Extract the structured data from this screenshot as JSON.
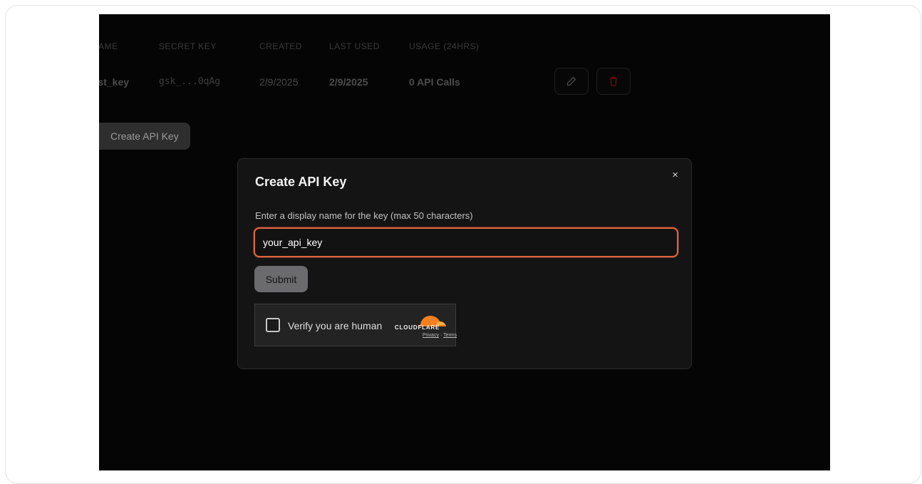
{
  "table": {
    "headers": [
      "NAME",
      "SECRET KEY",
      "CREATED",
      "LAST USED",
      "USAGE (24HRS)"
    ],
    "row": {
      "name": "test_key",
      "secret": "gsk_...0qAg",
      "created": "2/9/2025",
      "last_used": "2/9/2025",
      "usage": "0 API Calls"
    }
  },
  "create_button_label": "Create API Key",
  "modal": {
    "title": "Create API Key",
    "label": "Enter a display name for the key (max 50 characters)",
    "input_value": "your_api_key",
    "submit_label": "Submit",
    "close_symbol": "×"
  },
  "captcha": {
    "label": "Verify you are human",
    "brand": "CLOUDFLARE",
    "privacy": "Privacy",
    "separator": "·",
    "terms": "Terms"
  },
  "colors": {
    "accent": "#e0643e",
    "cloudflare_orange": "#f38020",
    "delete_red": "#8a1010"
  },
  "icons": [
    "pencil-icon",
    "trash-icon",
    "close-icon",
    "cloudflare-logo"
  ]
}
